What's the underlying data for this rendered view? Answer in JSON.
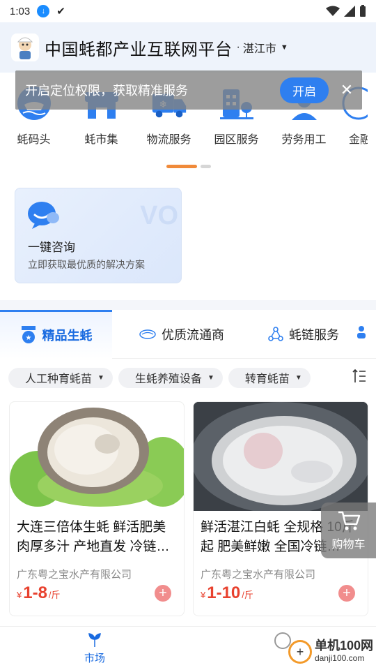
{
  "status": {
    "time": "1:03"
  },
  "header": {
    "title": "中国蚝都产业互联网平台",
    "city": "湛江市",
    "city_prefix": "·"
  },
  "categories": [
    {
      "label": "蚝码头",
      "icon": "dock-icon"
    },
    {
      "label": "蚝市集",
      "icon": "market-icon"
    },
    {
      "label": "物流服务",
      "icon": "truck-icon"
    },
    {
      "label": "园区服务",
      "icon": "park-icon"
    },
    {
      "label": "劳务用工",
      "icon": "worker-icon"
    },
    {
      "label": "金融",
      "icon": "finance-icon"
    }
  ],
  "location_banner": {
    "text": "开启定位权限，获取精准服务",
    "button": "开启"
  },
  "consult": {
    "title": "一键咨询",
    "subtitle": "立即获取最优质的解决方案"
  },
  "tabs": [
    {
      "label": "精品生蚝"
    },
    {
      "label": "优质流通商"
    },
    {
      "label": "蚝链服务"
    }
  ],
  "filters": [
    {
      "label": "人工种育蚝苗"
    },
    {
      "label": "生蚝养殖设备"
    },
    {
      "label": "转育蚝苗"
    }
  ],
  "products": [
    {
      "name": "大连三倍体生蚝 鲜活肥美肉厚多汁 产地直发 冷链…",
      "company": "广东粤之宝水产有限公司",
      "currency": "¥",
      "price": "1-8",
      "unit": "/斤"
    },
    {
      "name": "鲜活湛江白蚝 全规格 10斤起 肥美鲜嫩 全国冷链…",
      "company": "广东粤之宝水产有限公司",
      "currency": "¥",
      "price": "1-10",
      "unit": "/斤"
    }
  ],
  "float_cart": {
    "label": "购物车"
  },
  "bottom_nav": {
    "market": "市场"
  },
  "watermark": {
    "main": "单机100网",
    "sub": "danji100.com"
  },
  "colors": {
    "accent": "#2e7ff0",
    "price": "#e8412e",
    "pager_active": "#f08a3a"
  }
}
